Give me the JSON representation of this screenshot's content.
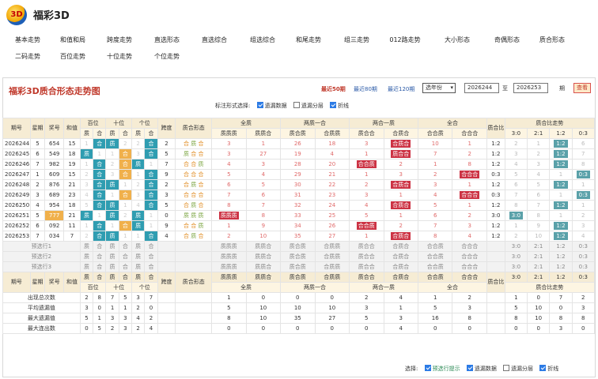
{
  "app": {
    "title": "福彩3D",
    "logo_text": "3D"
  },
  "nav": {
    "rows": [
      [
        "基本走势",
        "和值和局",
        "跨度走势",
        "直选形态",
        "直选综合",
        "组选综合",
        "和尾走势",
        "组三走势",
        "012路走势",
        "大小形态",
        "奇偶形态",
        "质合形态"
      ],
      [
        "二码走势",
        "百位走势",
        "十位走势",
        "个位走势"
      ]
    ]
  },
  "panel": {
    "title": "福彩3D质合形态走势图",
    "periods": [
      "最近50期",
      "最近80期",
      "最近120期"
    ],
    "year_select": "选年份",
    "from_issue": "2026244",
    "to_label_from": "至",
    "to_issue": "2026253",
    "issue_unit": "期",
    "query": "查看",
    "opts_label": "标注形式选择:",
    "opts": [
      {
        "label": "遗漏数据",
        "on": true
      },
      {
        "label": "遗漏分层",
        "on": false
      },
      {
        "label": "折线",
        "on": true
      }
    ]
  },
  "table": {
    "h1": [
      "期号",
      "星期",
      "奖号",
      "和值",
      "百位",
      "十位",
      "个位",
      "跨度",
      "质合形态",
      "全质",
      "两质一合",
      "两合一质",
      "全合",
      "质合比",
      "质合比走势"
    ],
    "h2": [
      "质",
      "合",
      "质",
      "合",
      "质",
      "合",
      "质质质",
      "质质合",
      "质合质",
      "合质质",
      "质合合",
      "合质合",
      "合合质",
      "合合合",
      "3:0",
      "2:1",
      "1:2",
      "0:3"
    ],
    "rows": [
      {
        "issue": "2026244",
        "wk": "5",
        "num": "654",
        "sum": "15",
        "b": [
          "1",
          "合"
        ],
        "s": [
          "质",
          "2"
        ],
        "g": [
          "2",
          "合"
        ],
        "span": "2",
        "form": "合 质 合",
        "cols": [
          "3",
          "1",
          "26",
          "18",
          "3",
          "合质合",
          "10",
          "1"
        ],
        "ratio": "1:2",
        "rt": [
          "2",
          "1",
          "1:2",
          "6"
        ]
      },
      {
        "issue": "2026245",
        "wk": "6",
        "num": "549",
        "sum": "18",
        "b": [
          "质",
          "1"
        ],
        "s": [
          "1",
          "合"
        ],
        "g": [
          "3",
          "合"
        ],
        "span": "5",
        "form": "质 合 合",
        "cols": [
          "3",
          "27",
          "19",
          "4",
          "1",
          "质合合",
          "7",
          "2"
        ],
        "ratio": "1:2",
        "rt": [
          "3",
          "2",
          "1:2",
          "7"
        ]
      },
      {
        "issue": "2026246",
        "wk": "7",
        "num": "982",
        "sum": "19",
        "b": [
          "1",
          "合"
        ],
        "s": [
          "2",
          "合"
        ],
        "g": [
          "质",
          "1"
        ],
        "span": "7",
        "form": "合 合 质",
        "cols": [
          "4",
          "3",
          "28",
          "20",
          "合合质",
          "2",
          "1",
          "8"
        ],
        "ratio": "1:2",
        "rt": [
          "4",
          "3",
          "1:2",
          "8"
        ]
      },
      {
        "issue": "2026247",
        "wk": "1",
        "num": "609",
        "sum": "15",
        "b": [
          "2",
          "合"
        ],
        "s": [
          "3",
          "合"
        ],
        "g": [
          "1",
          "合"
        ],
        "span": "9",
        "form": "合 合 合",
        "cols": [
          "5",
          "4",
          "29",
          "21",
          "1",
          "3",
          "2",
          "合合合"
        ],
        "ratio": "0:3",
        "rt": [
          "5",
          "4",
          "1",
          "0:3"
        ]
      },
      {
        "issue": "2026248",
        "wk": "2",
        "num": "876",
        "sum": "21",
        "b": [
          "3",
          "合"
        ],
        "s": [
          "质",
          "1"
        ],
        "g": [
          "2",
          "合"
        ],
        "span": "2",
        "form": "合 质 合",
        "cols": [
          "6",
          "5",
          "30",
          "22",
          "2",
          "合质合",
          "3",
          "1"
        ],
        "ratio": "1:2",
        "rt": [
          "6",
          "5",
          "1:2",
          "1"
        ]
      },
      {
        "issue": "2026249",
        "wk": "3",
        "num": "689",
        "sum": "23",
        "b": [
          "4",
          "合"
        ],
        "s": [
          "1",
          "合"
        ],
        "g": [
          "3",
          "合"
        ],
        "span": "3",
        "form": "合 合 合",
        "cols": [
          "7",
          "6",
          "31",
          "23",
          "3",
          "1",
          "4",
          "合合合"
        ],
        "ratio": "0:3",
        "rt": [
          "7",
          "6",
          "1",
          "0:3"
        ]
      },
      {
        "issue": "2026250",
        "wk": "4",
        "num": "954",
        "sum": "18",
        "b": [
          "5",
          "合"
        ],
        "s": [
          "质",
          "1"
        ],
        "g": [
          "4",
          "合"
        ],
        "span": "5",
        "form": "合 质 合",
        "cols": [
          "8",
          "7",
          "32",
          "24",
          "4",
          "合质合",
          "5",
          "1"
        ],
        "ratio": "1:2",
        "rt": [
          "8",
          "7",
          "1:2",
          "1"
        ]
      },
      {
        "issue": "2026251",
        "wk": "5",
        "num": "777",
        "sum": "21",
        "b": [
          "质",
          "1"
        ],
        "s": [
          "质",
          "2"
        ],
        "g": [
          "质",
          "1"
        ],
        "span": "0",
        "form": "质 质 质",
        "cols": [
          "质质质",
          "8",
          "33",
          "25",
          "5",
          "1",
          "6",
          "2"
        ],
        "ratio": "3:0",
        "rt": [
          "3:0",
          "8",
          "1",
          "2"
        ]
      },
      {
        "issue": "2026252",
        "wk": "6",
        "num": "092",
        "sum": "11",
        "b": [
          "1",
          "合"
        ],
        "s": [
          "1",
          "合"
        ],
        "g": [
          "质",
          "1"
        ],
        "span": "9",
        "form": "合 合 质",
        "cols": [
          "1",
          "9",
          "34",
          "26",
          "合合质",
          "2",
          "7",
          "3"
        ],
        "ratio": "1:2",
        "rt": [
          "1",
          "9",
          "1:2",
          "3"
        ]
      },
      {
        "issue": "2026253",
        "wk": "7",
        "num": "034",
        "sum": "7",
        "b": [
          "2",
          "合"
        ],
        "s": [
          "质",
          "1"
        ],
        "g": [
          "1",
          "合"
        ],
        "span": "4",
        "form": "合 质 合",
        "cols": [
          "2",
          "10",
          "35",
          "27",
          "1",
          "合质合",
          "8",
          "4"
        ],
        "ratio": "1:2",
        "rt": [
          "2",
          "10",
          "1:2",
          "4"
        ]
      }
    ],
    "pre": [
      "预选行1",
      "预选行2",
      "预选行3"
    ],
    "pre_cells": [
      "质",
      "合",
      "质",
      "合",
      "质",
      "合"
    ],
    "pre_cols": [
      "质质质",
      "质质合",
      "质合质",
      "合质质",
      "质合合",
      "合质合",
      "合合质",
      "合合合"
    ],
    "pre_rt": [
      "3:0",
      "2:1",
      "1:2",
      "0:3"
    ],
    "foot1": [
      "期号",
      "星期",
      "奖号",
      "和值",
      "质",
      "合",
      "质",
      "合",
      "质",
      "合",
      "跨度",
      "质合形态",
      "质质质",
      "质质合",
      "质合质",
      "合质质",
      "质合合",
      "合质合",
      "合合质",
      "合合合",
      "质合比",
      "3:0",
      "2:1",
      "1:2",
      "0:3"
    ],
    "foot2": [
      "百位",
      "十位",
      "个位",
      "全质",
      "两质一合",
      "两合一质",
      "全合",
      "质合比走势"
    ],
    "stats": [
      {
        "label": "出现总次数",
        "v": [
          "2",
          "8",
          "7",
          "5",
          "3",
          "7"
        ],
        "c": [
          "1",
          "0",
          "0",
          "0",
          "2",
          "4",
          "1",
          "2"
        ],
        "r": [
          "1",
          "0",
          "7",
          "2"
        ]
      },
      {
        "label": "平均遗漏值",
        "v": [
          "3",
          "0",
          "1",
          "1",
          "2",
          "0"
        ],
        "c": [
          "5",
          "10",
          "10",
          "10",
          "3",
          "1",
          "5",
          "3"
        ],
        "r": [
          "5",
          "10",
          "0",
          "3"
        ]
      },
      {
        "label": "最大遗漏值",
        "v": [
          "5",
          "1",
          "3",
          "3",
          "4",
          "2"
        ],
        "c": [
          "8",
          "10",
          "35",
          "27",
          "5",
          "3",
          "16",
          "8"
        ],
        "r": [
          "8",
          "10",
          "8",
          "8"
        ]
      },
      {
        "label": "最大连出数",
        "v": [
          "0",
          "5",
          "2",
          "3",
          "2",
          "4"
        ],
        "c": [
          "0",
          "0",
          "0",
          "0",
          "0",
          "4",
          "0",
          "0"
        ],
        "r": [
          "0",
          "0",
          "3",
          "0"
        ]
      }
    ]
  },
  "bottom": {
    "label": "选择:",
    "opts": [
      {
        "label": "预选行提示",
        "on": true
      },
      {
        "label": "遗漏数据",
        "on": true
      },
      {
        "label": "遗漏分层",
        "on": false
      },
      {
        "label": "折线",
        "on": true
      }
    ]
  }
}
